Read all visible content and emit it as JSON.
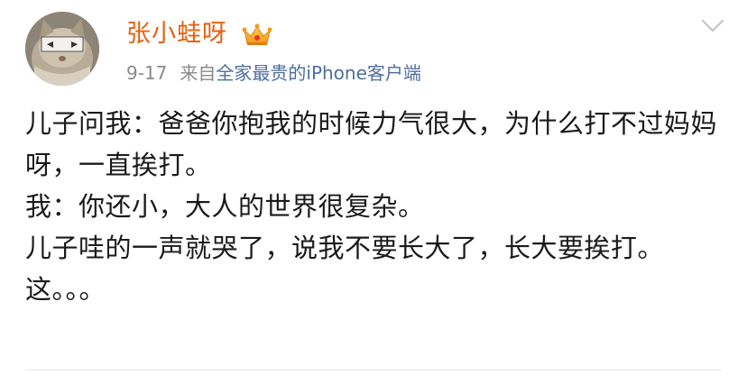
{
  "post": {
    "username": "张小蛙呀",
    "date": "9-17",
    "source_prefix": "来自",
    "source_device": "全家最贵的iPhone客户端",
    "content_lines": [
      "儿子问我：爸爸你抱我的时候力气很大，为什么打不过妈妈呀，一直挨打。",
      "我：你还小，大人的世界很复杂。",
      "儿子哇的一声就哭了，说我不要长大了，长大要挨打。",
      "这。。。"
    ]
  },
  "icons": {
    "badge": "crown-icon",
    "menu": "chevron-down-icon",
    "avatar": "cat-avatar"
  },
  "colors": {
    "username": "#e8610f",
    "source_link": "#4e6e9c",
    "meta": "#8a8a8a",
    "text": "#1a1a1a"
  }
}
